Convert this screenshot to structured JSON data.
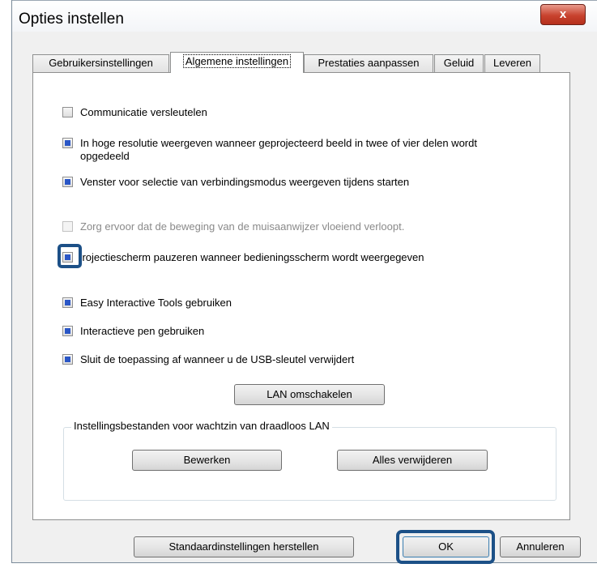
{
  "window": {
    "title": "Opties instellen",
    "close_glyph": "x"
  },
  "tabs": [
    {
      "label": "Gebruikersinstellingen",
      "active": false
    },
    {
      "label": "Algemene instellingen",
      "active": true
    },
    {
      "label": "Prestaties aanpassen",
      "active": false
    },
    {
      "label": "Geluid",
      "active": false
    },
    {
      "label": "Leveren",
      "active": false
    }
  ],
  "options": [
    {
      "label": "Communicatie versleutelen",
      "checked": false,
      "enabled": true
    },
    {
      "label": "In hoge resolutie weergeven wanneer geprojecteerd beeld in twee of vier delen wordt",
      "label2": "opgedeeld",
      "checked": true,
      "enabled": true
    },
    {
      "label": "Venster voor selectie van verbindingsmodus weergeven tijdens starten",
      "checked": true,
      "enabled": true
    },
    {
      "label": "Zorg ervoor dat de beweging van de muisaanwijzer vloeiend verloopt.",
      "checked": false,
      "enabled": false
    },
    {
      "label": "'rojectiescherm pauzeren wanneer bedieningsscherm wordt weergegeven",
      "checked": true,
      "enabled": true
    },
    {
      "label": "Easy Interactive Tools gebruiken",
      "checked": true,
      "enabled": true
    },
    {
      "label": "Interactieve pen gebruiken",
      "checked": true,
      "enabled": true
    },
    {
      "label": "Sluit de toepassing af wanneer u de USB-sleutel verwijdert",
      "checked": true,
      "enabled": true
    }
  ],
  "lan_button": "LAN omschakelen",
  "group": {
    "title": "Instellingsbestanden voor wachtzin van draadloos LAN",
    "edit_button": "Bewerken",
    "delete_all_button": "Alles verwijderen"
  },
  "footer": {
    "restore_button": "Standaardinstellingen herstellen",
    "ok_button": "OK",
    "cancel_button": "Annuleren"
  },
  "colors": {
    "highlight": "#1c5087",
    "checkbox_fill": "#2a56c6"
  }
}
